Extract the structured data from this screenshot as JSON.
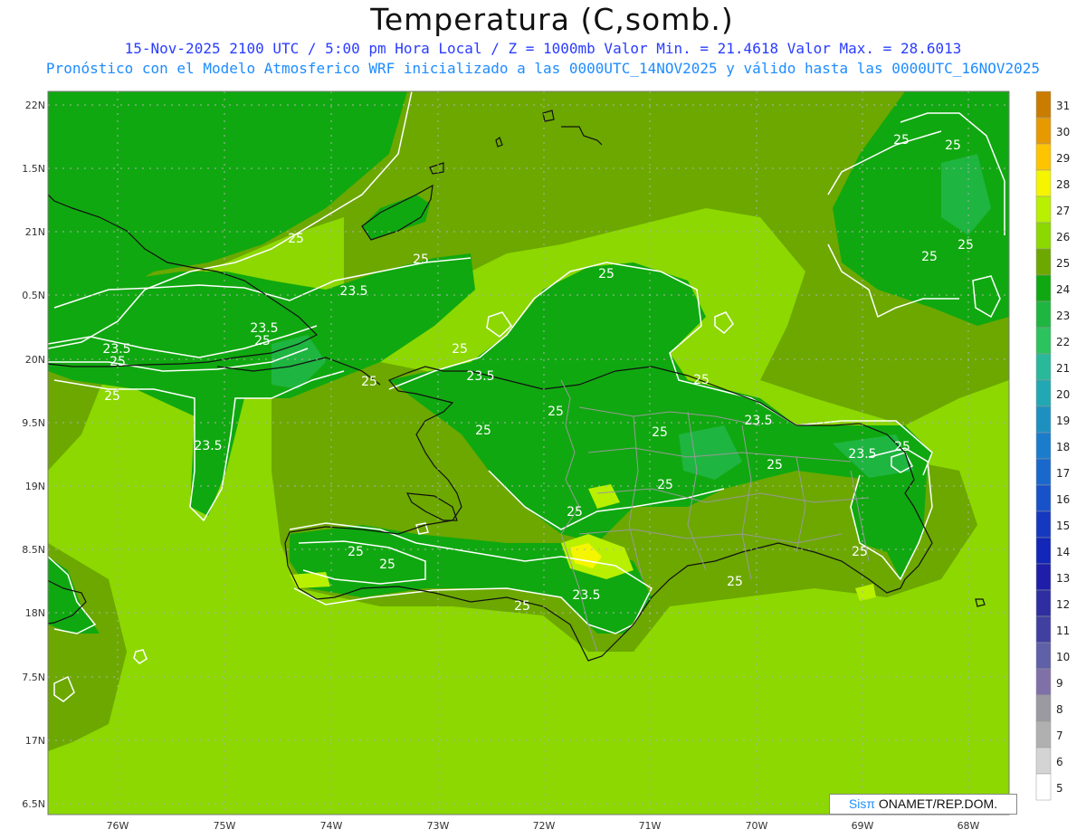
{
  "title": "Temperatura (C,somb.)",
  "subtitle_line1": "15-Nov-2025  2100 UTC / 5:00 pm Hora Local / Z = 1000mb   Valor Min. = 21.4618  Valor Max. = 28.6013",
  "subtitle_line2": "Pronóstico con el Modelo Atmosferico WRF inicializado a las 0000UTC_14NOV2025 y válido hasta las  0000UTC_16NOV2025",
  "credit": {
    "brand": "Sisπ",
    "text": " ONAMET/REP.DOM."
  },
  "lat_ticks": [
    "22N",
    "1.5N",
    "21N",
    "0.5N",
    "20N",
    "9.5N",
    "19N",
    "8.5N",
    "18N",
    "7.5N",
    "17N",
    "6.5N"
  ],
  "lon_ticks": [
    "76W",
    "75W",
    "74W",
    "73W",
    "72W",
    "71W",
    "70W",
    "69W",
    "68W"
  ],
  "legend": {
    "levels": [
      "31",
      "30",
      "29",
      "28",
      "27",
      "26",
      "25",
      "24",
      "23",
      "22",
      "21",
      "20",
      "19",
      "18",
      "17",
      "16",
      "15",
      "14",
      "13",
      "12",
      "11",
      "10",
      "9",
      "8",
      "7",
      "6",
      "5"
    ],
    "colors": [
      "#c97c00",
      "#e69a00",
      "#ffc400",
      "#f5f500",
      "#b8f000",
      "#8cd800",
      "#6ca800",
      "#10a810",
      "#1fb541",
      "#2cc25e",
      "#2ab89a",
      "#22a8b2",
      "#1e90c0",
      "#1c7ccc",
      "#1a68cc",
      "#1852c8",
      "#1538c0",
      "#1226b8",
      "#1e1ea8",
      "#2e2ea0",
      "#4040a0",
      "#6060a8",
      "#8070a8",
      "#9a9aa0",
      "#b0b0b0",
      "#d4d4d4",
      "#ffffff"
    ]
  },
  "contour_labels": [
    "25",
    "23.5",
    "25",
    "23.5",
    "25",
    "23.5",
    "25",
    "25",
    "23.5",
    "25",
    "25",
    "25",
    "23.5",
    "25",
    "25",
    "25",
    "25",
    "25",
    "23.5",
    "25",
    "25",
    "25",
    "25",
    "25",
    "25",
    "23.5",
    "25",
    "25",
    "25",
    "23.5",
    "25",
    "25",
    "25"
  ],
  "colors": {
    "ocean_warm": "#8cd800",
    "land_cool": "#10a810",
    "mid": "#6ca800",
    "warm_spot": "#b8f000",
    "hot_spot": "#f5f500",
    "contour": "#ffffff",
    "coast": "#111111",
    "border": "#999999"
  }
}
